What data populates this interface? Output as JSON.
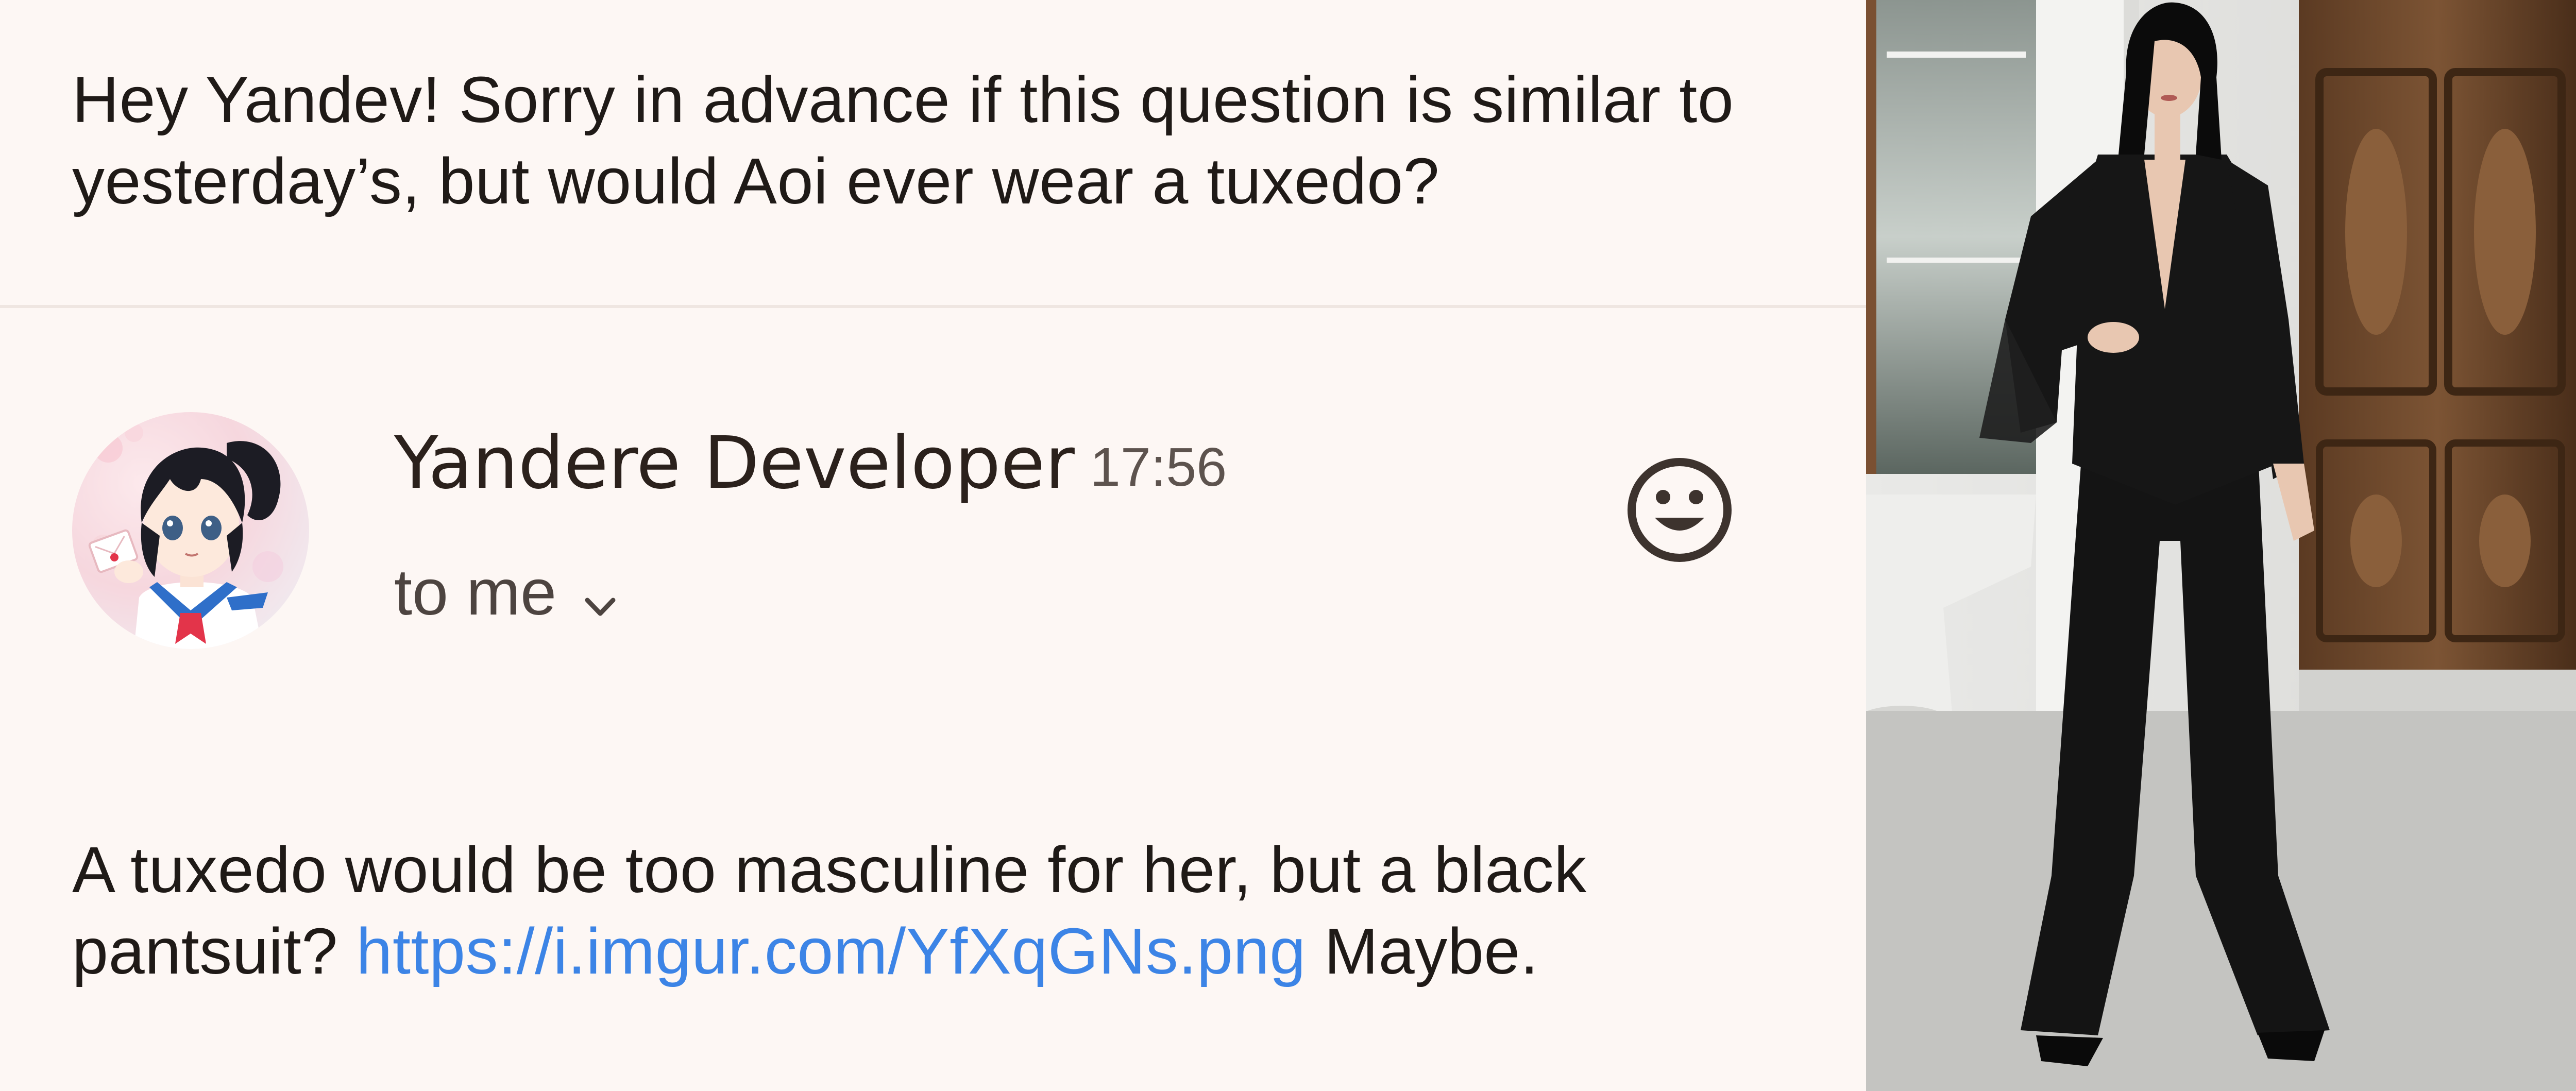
{
  "question": {
    "text": "Hey Yandev! Sorry in advance if this question is similar to yesterday’s, but would Aoi ever wear a tuxedo?"
  },
  "email": {
    "sender_name": "Yandere Developer",
    "time": "17:56",
    "recipient_label": "to me",
    "chevron_icon": "chevron-down-icon",
    "emoji_icon": "smiley-face-icon",
    "avatar_icon": "anime-schoolgirl-avatar"
  },
  "reply": {
    "text_before": "A tuxedo would be too masculine for her, but a black pantsuit?",
    "link_text": "https://i.imgur.com/YfXqGNs.png",
    "text_after": "Maybe."
  },
  "photo": {
    "subject": "woman-in-black-pantsuit-photo"
  },
  "colors": {
    "background": "#fdf7f4",
    "text": "#1f1a17",
    "link": "#3c84e6",
    "divider": "#efe6e1"
  }
}
